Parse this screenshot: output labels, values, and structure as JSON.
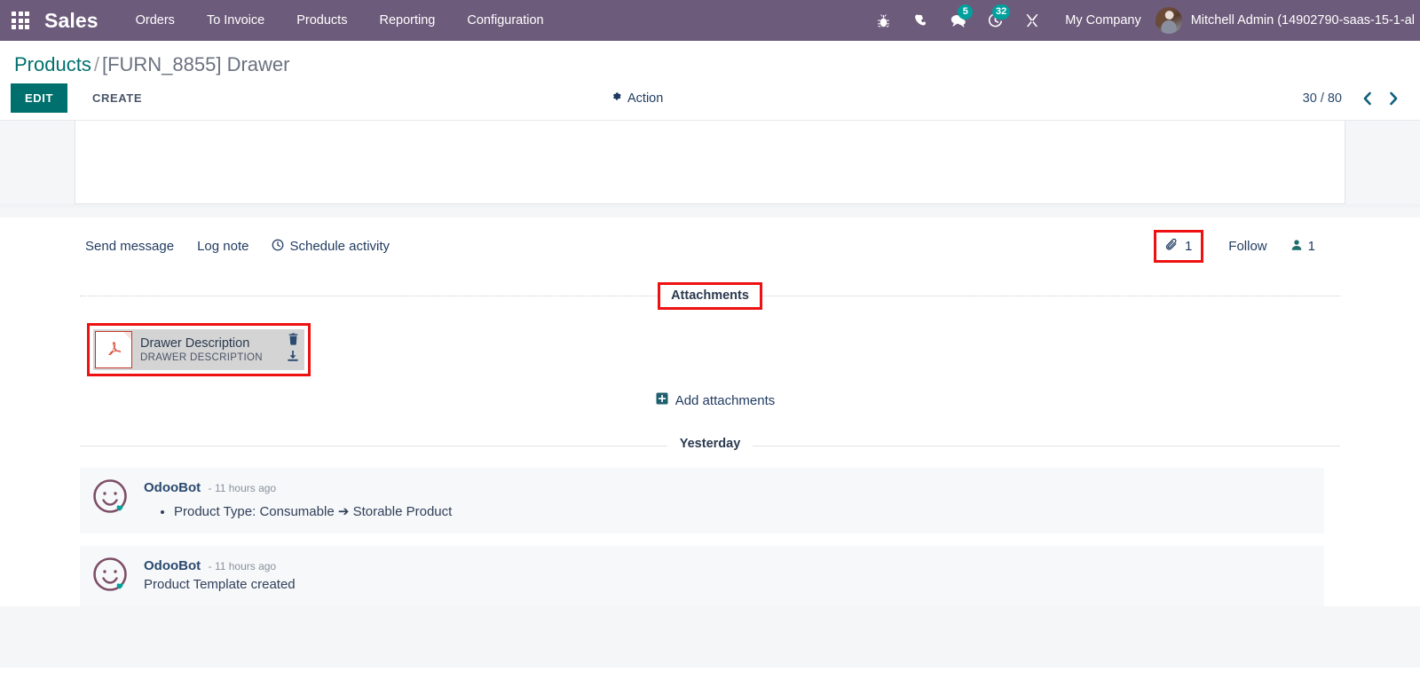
{
  "navbar": {
    "apps_icon": "apps-grid-icon",
    "brand": "Sales",
    "menu": [
      {
        "label": "Orders"
      },
      {
        "label": "To Invoice"
      },
      {
        "label": "Products"
      },
      {
        "label": "Reporting"
      },
      {
        "label": "Configuration"
      }
    ],
    "sys_icons": [
      {
        "name": "bug-icon",
        "badge": ""
      },
      {
        "name": "phone-icon",
        "badge": ""
      },
      {
        "name": "messages-icon",
        "badge": "5"
      },
      {
        "name": "activities-clock-icon",
        "badge": "32"
      },
      {
        "name": "tools-icon",
        "badge": ""
      }
    ],
    "company": "My Company",
    "user": "Mitchell Admin (14902790-saas-15-1-al"
  },
  "control_panel": {
    "breadcrumb_root": "Products",
    "breadcrumb_sep": "/",
    "breadcrumb_current": "[FURN_8855] Drawer",
    "edit_label": "EDIT",
    "create_label": "CREATE",
    "action_label": "Action",
    "action_icon": "gear-icon",
    "pager_count": "30 / 80",
    "pager_prev_icon": "chevron-left-icon",
    "pager_next_icon": "chevron-right-icon"
  },
  "chatter": {
    "send_message": "Send message",
    "log_note": "Log note",
    "schedule_activity": "Schedule activity",
    "schedule_icon": "clock-icon",
    "attachment_icon": "paperclip-icon",
    "attachment_count": "1",
    "follow_label": "Follow",
    "followers_icon": "user-icon",
    "followers_count": "1",
    "attachments_title": "Attachments",
    "add_attachments_label": "Add attachments",
    "add_attachments_icon": "plus-square-icon",
    "attachments": [
      {
        "name": "Drawer Description",
        "subtitle": "DRAWER DESCRIPTION",
        "file_type": "pdf",
        "delete_icon": "trash-icon",
        "download_icon": "download-icon"
      }
    ],
    "day_divider": "Yesterday",
    "messages": [
      {
        "author": "OdooBot",
        "time": "- 11 hours ago",
        "tracking": [
          "Product Type: Consumable ➔ Storable Product"
        ],
        "text": ""
      },
      {
        "author": "OdooBot",
        "time": "- 11 hours ago",
        "tracking": [],
        "text": "Product Template created"
      }
    ]
  },
  "colors": {
    "navbar_bg": "#6d5b7b",
    "primary": "#00706e",
    "badge": "#00a09d",
    "highlight": "#ee1111",
    "link": "#1f3a5f",
    "message_bg": "#f6f8fa"
  }
}
